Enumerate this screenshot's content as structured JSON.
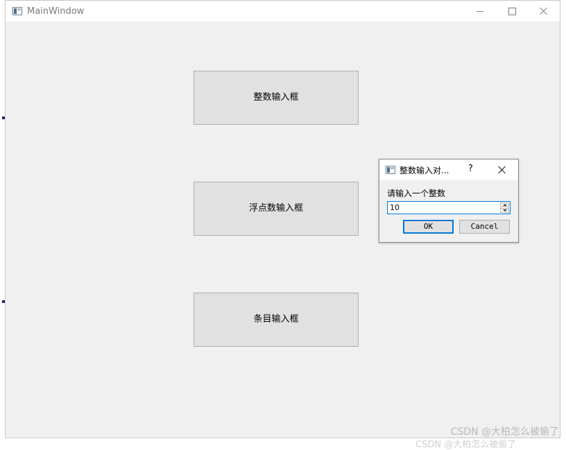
{
  "main_window": {
    "title": "MainWindow",
    "buttons": {
      "integer": "整数输入框",
      "float": "浮点数输入框",
      "item": "条目输入框"
    }
  },
  "dialog": {
    "title": "整数输入对...",
    "help": "?",
    "prompt": "请输入一个整数",
    "value": "10",
    "ok_label": "OK",
    "cancel_label": "Cancel"
  },
  "watermark": "CSDN @大柏怎么被偷了",
  "colors": {
    "accent": "#0078d7",
    "window_bg": "#f0f0f0",
    "button_bg": "#e1e1e1"
  }
}
